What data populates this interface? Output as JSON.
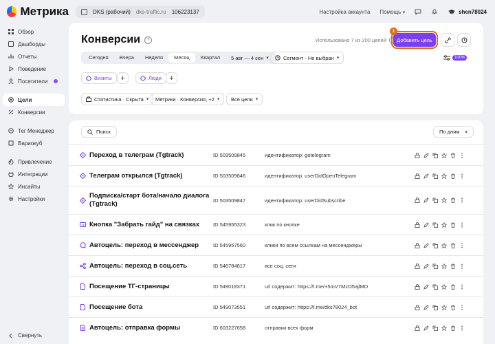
{
  "app": {
    "logo_text": "Метрика"
  },
  "topbar": {
    "counter_name": "DKS (рабочий)",
    "site": "dks-traffic.ru",
    "counter_id": "106223137",
    "account_settings": "Настройка аккаунта",
    "help": "Помощь",
    "username": "shen78024"
  },
  "sidebar": {
    "items": [
      {
        "label": "Обзор",
        "icon": "grid-icon"
      },
      {
        "label": "Дашборды",
        "icon": "dashboard-icon"
      },
      {
        "label": "Отчеты",
        "icon": "report-icon"
      },
      {
        "label": "Поведение",
        "icon": "play-icon"
      },
      {
        "label": "Посетители",
        "icon": "user-icon"
      },
      {
        "label": "Цели",
        "icon": "target-icon"
      },
      {
        "label": "Конверсии",
        "icon": "percent-icon"
      },
      {
        "label": "Тег Менеджер",
        "icon": "tag-icon"
      },
      {
        "label": "Вариокуб",
        "icon": "cube-icon"
      },
      {
        "label": "Привлечение",
        "icon": "fire-icon"
      },
      {
        "label": "Интеграции",
        "icon": "plug-icon"
      },
      {
        "label": "Инсайты",
        "icon": "bulb-icon"
      },
      {
        "label": "Настройки",
        "icon": "gear-icon"
      }
    ],
    "collapse": "Свернуть"
  },
  "header": {
    "title": "Конверсии",
    "used_goals": "Использовано 7 из 200 целей",
    "add_goal": "Добавить цель",
    "step_badge": "1"
  },
  "period": {
    "tabs": [
      "Сегодня",
      "Вчера",
      "Неделя",
      "Месяц",
      "Квартал"
    ],
    "active": "Месяц",
    "date_range": "5 авг — 4 сен",
    "segment": "Сегмент · Не выбран",
    "percent_badge": "100%"
  },
  "filters": {
    "visits": "Визиты",
    "people": "Люди",
    "stats": "Статистика · Скрыта",
    "metrics": "Метрики · Конверсия, +2",
    "all_goals": "Все цели"
  },
  "list": {
    "search_label": "Поиск",
    "group_by": "По дням",
    "goals": [
      {
        "name": "Переход в телеграм (Tgtrack)",
        "id": "ID 503509845",
        "condition": "идентификатор: gotelegram",
        "icon": "event-icon"
      },
      {
        "name": "Телеграм открылся (Tgtrack)",
        "id": "ID 503509846",
        "condition": "идентификатор: userDidOpenTelegram",
        "icon": "event-icon"
      },
      {
        "name": "Подписка/старт бота/начало диалога (Tgtrack)",
        "id": "ID 503509847",
        "condition": "идентификатор: userDidSubscribe",
        "icon": "event-icon"
      },
      {
        "name": "Кнопка \"Забрать гайд\" на связках",
        "id": "ID 545955323",
        "condition": "клик по кнопке",
        "icon": "click-icon"
      },
      {
        "name": "Автоцель: переход в мессенджер",
        "id": "ID 545957560",
        "condition": "клики по всем ссылкам на мессенджеры",
        "icon": "chat-icon"
      },
      {
        "name": "Автоцель: переход в соц.сеть",
        "id": "ID 546784817",
        "condition": "все соц. сети",
        "icon": "share-icon"
      },
      {
        "name": "Посещение ТГ-страницы",
        "id": "ID 549018371",
        "condition": "url содержит: https://t.me/+5mV7MzO5ajlMDhi",
        "icon": "page-icon"
      },
      {
        "name": "Посещение бота",
        "id": "ID 549073551",
        "condition": "url содержит: https://t.me/dks78024_bot",
        "icon": "page-icon"
      },
      {
        "name": "Автоцель: отправка формы",
        "id": "ID 603227658",
        "condition": "отправки всех форм",
        "icon": "form-icon"
      }
    ]
  },
  "colors": {
    "accent": "#7b3ff2",
    "highlight": "#e06b1a",
    "background": "#f0f1f5"
  }
}
